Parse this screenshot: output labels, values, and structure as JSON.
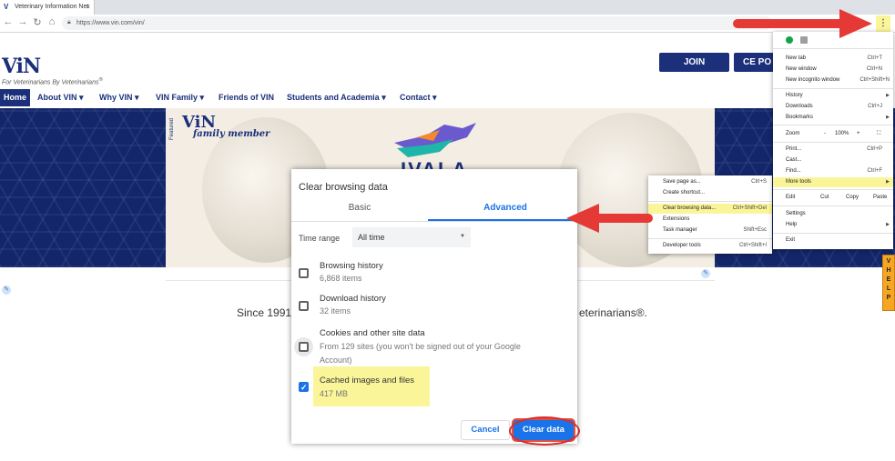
{
  "browser": {
    "tab_title": "Veterinary Information Net",
    "tab_close": "×",
    "url": "https://www.vin.com/vin/",
    "menu_button": "⋮"
  },
  "site": {
    "logo": "ViN",
    "tagline": "For Veterinarians By Veterinarians",
    "tagline_reg": "®",
    "join_label": "JOIN",
    "ce_label": "CE PO",
    "nav": [
      {
        "label": "Home"
      },
      {
        "label": "About VIN ▾"
      },
      {
        "label": "Why VIN ▾"
      },
      {
        "label": "VIN Family ▾"
      },
      {
        "label": "Friends of VIN"
      },
      {
        "label": "Students and Academia ▾"
      },
      {
        "label": "Contact ▾"
      }
    ],
    "hero": {
      "featured": "Featured",
      "vin_logo": "ViN",
      "family_member": "family member",
      "brand": "IVALA"
    },
    "since_left": "Since 1991,",
    "since_right": "eterinarians®.",
    "help_tab": [
      "V",
      "H",
      "E",
      "L",
      "P"
    ]
  },
  "dialog": {
    "title": "Clear browsing data",
    "tab_basic": "Basic",
    "tab_advanced": "Advanced",
    "time_range_label": "Time range",
    "time_range_value": "All time",
    "options": [
      {
        "title": "Browsing history",
        "subtitle": "6,868 items",
        "checked": false
      },
      {
        "title": "Download history",
        "subtitle": "32 items",
        "checked": false
      },
      {
        "title": "Cookies and other site data",
        "subtitle": "From 129 sites (you won't be signed out of your Google",
        "subtitle2": "Account)",
        "checked": false
      },
      {
        "title": "Cached images and files",
        "subtitle": "417 MB",
        "checked": true
      }
    ],
    "cancel": "Cancel",
    "clear": "Clear data"
  },
  "chrome_menu": {
    "items": [
      {
        "label": "New tab",
        "shortcut": "Ctrl+T"
      },
      {
        "label": "New window",
        "shortcut": "Ctrl+N"
      },
      {
        "label": "New incognito window",
        "shortcut": "Ctrl+Shift+N"
      },
      {
        "label": "History",
        "shortcut": ""
      },
      {
        "label": "Downloads",
        "shortcut": "Ctrl+J"
      },
      {
        "label": "Bookmarks",
        "shortcut": ""
      },
      {
        "label": "Print...",
        "shortcut": "Ctrl+P"
      },
      {
        "label": "Cast...",
        "shortcut": ""
      },
      {
        "label": "Find...",
        "shortcut": "Ctrl+F"
      },
      {
        "label": "More tools",
        "shortcut": ""
      },
      {
        "label": "Settings",
        "shortcut": ""
      },
      {
        "label": "Help",
        "shortcut": ""
      },
      {
        "label": "Exit",
        "shortcut": ""
      }
    ],
    "zoom_label": "Zoom",
    "zoom_minus": "-",
    "zoom_value": "100%",
    "zoom_plus": "+",
    "fullscreen": "⛶",
    "edit_label": "Edit",
    "cut": "Cut",
    "copy": "Copy",
    "paste": "Paste"
  },
  "submenu": {
    "items": [
      {
        "label": "Save page as...",
        "shortcut": "Ctrl+S"
      },
      {
        "label": "Create shortcut...",
        "shortcut": ""
      },
      {
        "label": "Clear browsing data...",
        "shortcut": "Ctrl+Shift+Del"
      },
      {
        "label": "Extensions",
        "shortcut": ""
      },
      {
        "label": "Task manager",
        "shortcut": "Shift+Esc"
      },
      {
        "label": "Developer tools",
        "shortcut": "Ctrl+Shift+I"
      }
    ]
  },
  "colors": {
    "brand_navy": "#1b2f7a",
    "chrome_blue": "#1a73e8",
    "highlight_yellow": "#fbf59a",
    "arrow_red": "#e53935"
  }
}
